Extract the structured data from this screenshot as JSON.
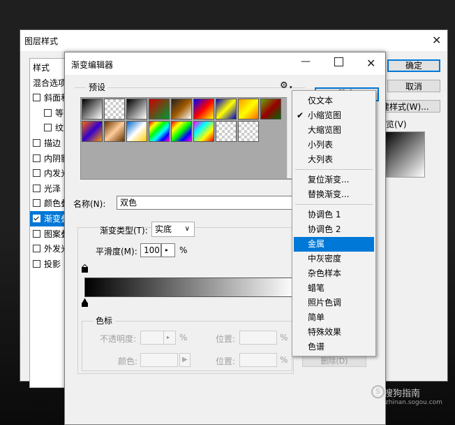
{
  "layer_style": {
    "title": "图层样式",
    "list_items": [
      {
        "label": "样式",
        "checkbox": false,
        "checked": false,
        "indent": false
      },
      {
        "label": "混合选项",
        "checkbox": false,
        "checked": false,
        "indent": false
      },
      {
        "label": "斜面和",
        "checkbox": true,
        "checked": false,
        "indent": false
      },
      {
        "label": "等高",
        "checkbox": true,
        "checked": false,
        "indent": true
      },
      {
        "label": "纹理",
        "checkbox": true,
        "checked": false,
        "indent": true
      },
      {
        "label": "描边",
        "checkbox": true,
        "checked": false,
        "indent": false
      },
      {
        "label": "内阴影",
        "checkbox": true,
        "checked": false,
        "indent": false
      },
      {
        "label": "内发光",
        "checkbox": true,
        "checked": false,
        "indent": false
      },
      {
        "label": "光泽",
        "checkbox": true,
        "checked": false,
        "indent": false
      },
      {
        "label": "颜色叠",
        "checkbox": true,
        "checked": false,
        "indent": false
      },
      {
        "label": "渐变叠",
        "checkbox": true,
        "checked": true,
        "indent": false,
        "selected": true
      },
      {
        "label": "图案叠",
        "checkbox": true,
        "checked": false,
        "indent": false
      },
      {
        "label": "外发光",
        "checkbox": true,
        "checked": false,
        "indent": false
      },
      {
        "label": "投影",
        "checkbox": true,
        "checked": false,
        "indent": false
      }
    ],
    "ok_label": "确定",
    "cancel_label": "取消",
    "new_style_label": "建样式(W)...",
    "preview_label": "预览(V)"
  },
  "gradient_editor": {
    "title": "渐变编辑器",
    "presets_label": "预设",
    "ok_label": "确定",
    "name_label": "名称(N):",
    "name_value": "双色",
    "type_label": "渐变类型(T):",
    "type_value": "实底",
    "smooth_label": "平滑度(M):",
    "smooth_value": "100",
    "smooth_unit": "%",
    "stops_group_label": "色标",
    "opacity_label": "不透明度:",
    "opacity_unit": "%",
    "color_label": "颜色:",
    "location_label": "位置:",
    "location_unit": "%",
    "delete_label": "删除(D)"
  },
  "preset_menu": {
    "items": [
      {
        "label": "仅文本",
        "checked": false
      },
      {
        "label": "小缩览图",
        "checked": true
      },
      {
        "label": "大缩览图",
        "checked": false
      },
      {
        "label": "小列表",
        "checked": false
      },
      {
        "label": "大列表",
        "checked": false
      },
      {
        "label": "复位渐变...",
        "checked": false
      },
      {
        "label": "替换渐变...",
        "checked": false
      },
      {
        "label": "协调色 1",
        "checked": false
      },
      {
        "label": "协调色 2",
        "checked": false
      },
      {
        "label": "金属",
        "checked": false,
        "highlighted": true
      },
      {
        "label": "中灰密度",
        "checked": false
      },
      {
        "label": "杂色样本",
        "checked": false
      },
      {
        "label": "蜡笔",
        "checked": false
      },
      {
        "label": "照片色调",
        "checked": false
      },
      {
        "label": "简单",
        "checked": false
      },
      {
        "label": "特殊效果",
        "checked": false
      },
      {
        "label": "色谱",
        "checked": false
      }
    ],
    "check_glyph": "✔"
  },
  "watermark": {
    "text": "搜狗指南",
    "url": "zhinan.sogou.com"
  },
  "colors": {
    "selection": "#0078d7",
    "dialog_bg": "#f0f0f0"
  },
  "icons": {
    "gear": "gear-icon",
    "close": "close-icon",
    "maximize": "maximize-icon",
    "minimize": "minimize-icon",
    "checkmark": "checkmark-icon",
    "chevron_down": "chevron-down-icon",
    "arrow_right": "arrow-right-icon"
  }
}
